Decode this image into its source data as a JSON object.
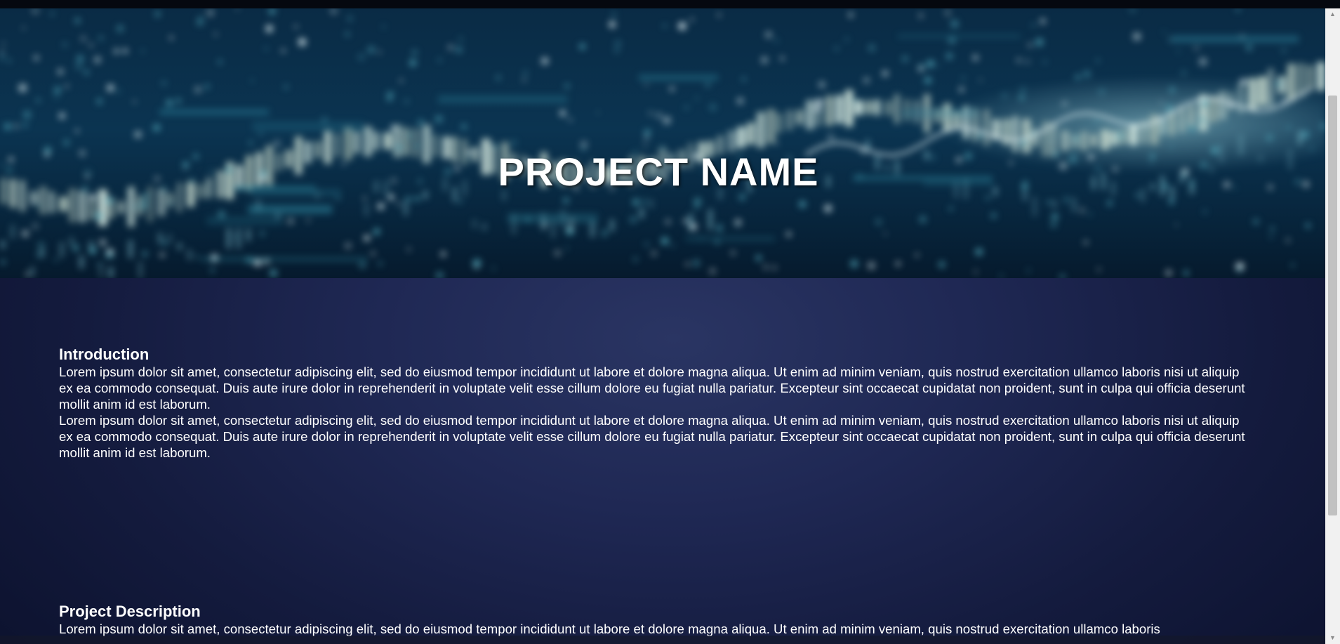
{
  "hero": {
    "title": "PROJECT NAME"
  },
  "sections": [
    {
      "heading": "Introduction",
      "paragraphs": [
        "Lorem ipsum dolor sit amet, consectetur adipiscing elit, sed do eiusmod tempor incididunt ut labore et dolore magna aliqua. Ut enim ad minim veniam, quis nostrud exercitation ullamco laboris nisi ut aliquip ex ea commodo consequat. Duis aute irure dolor in reprehenderit in voluptate velit esse cillum dolore eu fugiat nulla pariatur. Excepteur sint occaecat cupidatat non proident, sunt in culpa qui officia deserunt mollit anim id est laborum.",
        "Lorem ipsum dolor sit amet, consectetur adipiscing elit, sed do eiusmod tempor incididunt ut labore et dolore magna aliqua. Ut enim ad minim veniam, quis nostrud exercitation ullamco laboris nisi ut aliquip ex ea commodo consequat. Duis aute irure dolor in reprehenderit in voluptate velit esse cillum dolore eu fugiat nulla pariatur. Excepteur sint occaecat cupidatat non proident, sunt in culpa qui officia deserunt mollit anim id est laborum."
      ]
    },
    {
      "heading": "Project Description",
      "paragraphs": [
        "Lorem ipsum dolor sit amet, consectetur adipiscing elit, sed do eiusmod tempor incididunt ut labore et dolore magna aliqua. Ut enim ad minim veniam, quis nostrud exercitation ullamco laboris"
      ]
    }
  ],
  "scrollbar": {
    "up_icon": "triangle-up-icon",
    "down_icon": "triangle-down-icon"
  }
}
